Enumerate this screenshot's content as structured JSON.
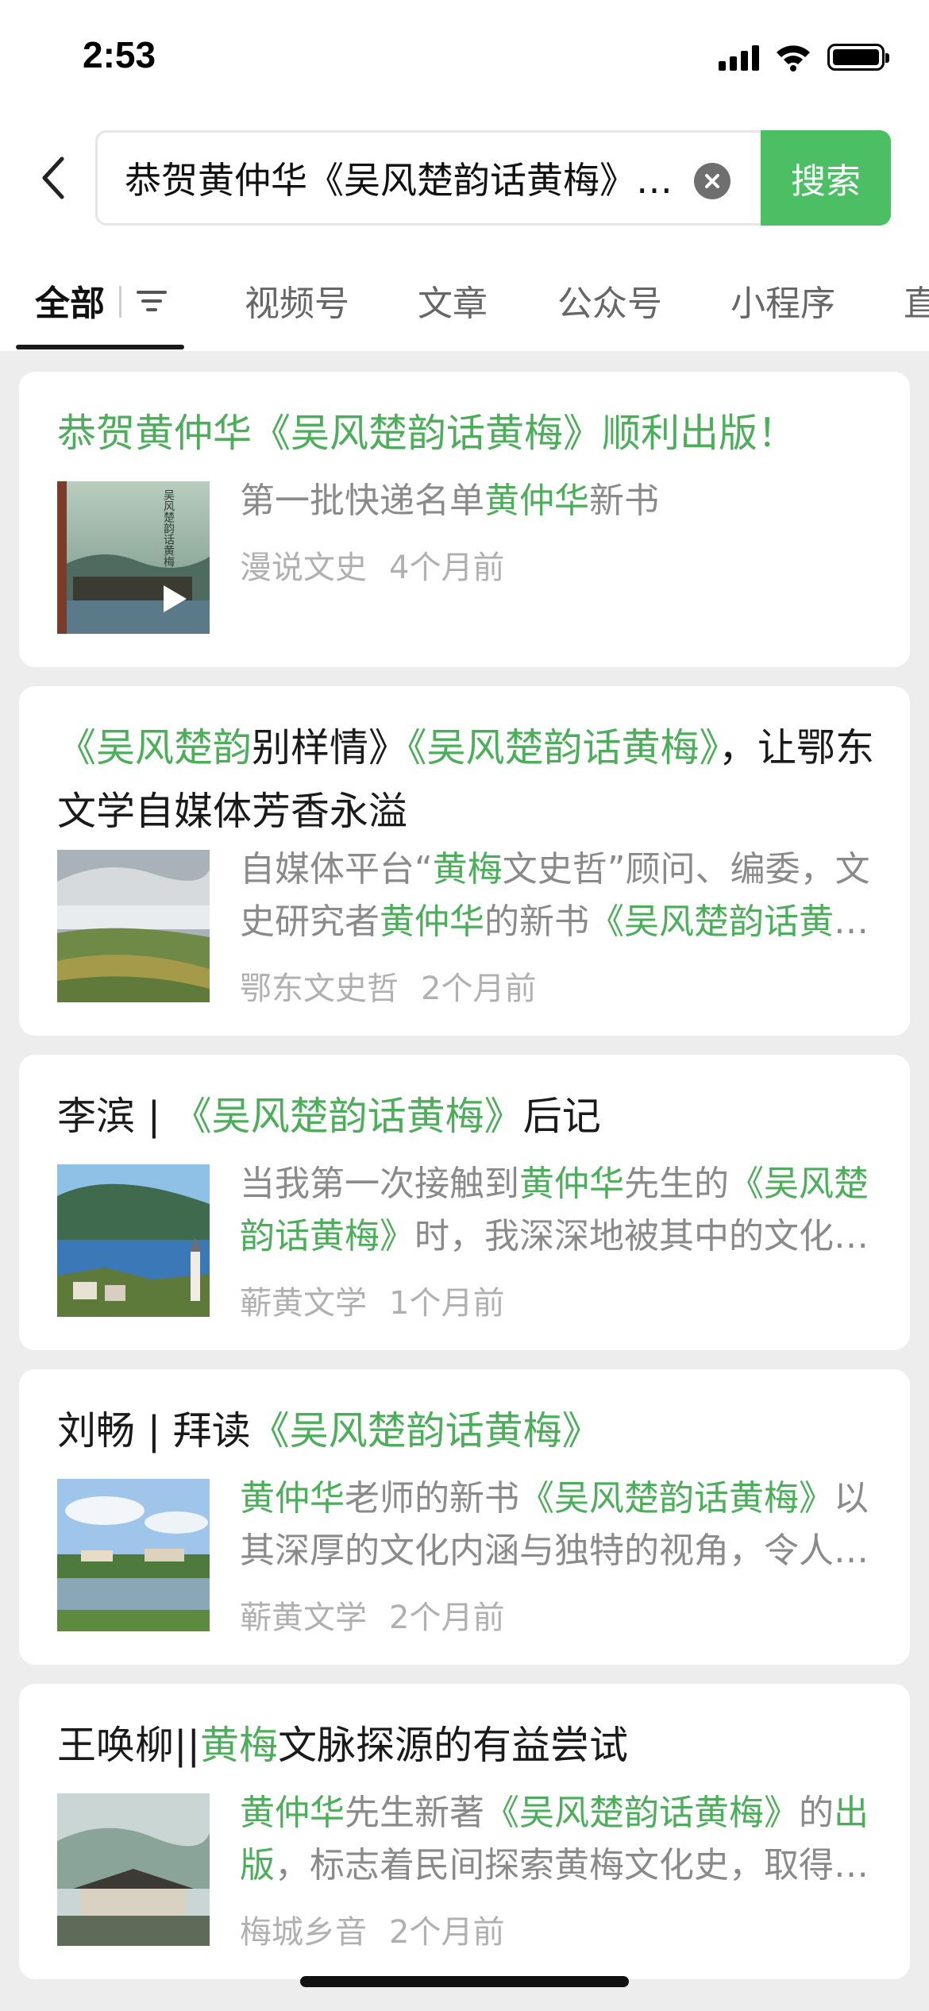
{
  "status_bar": {
    "time": "2:53",
    "icons": [
      "signal-icon",
      "wifi-icon",
      "battery-icon"
    ]
  },
  "search": {
    "query": "恭贺黄仲华《吴风楚韵话黄梅》顺利出版！",
    "button_label": "搜索",
    "back_icon": "chevron-left-icon",
    "clear_icon": "clear-icon"
  },
  "tabs": [
    {
      "label": "全部",
      "active": true
    },
    {
      "label": "视频号"
    },
    {
      "label": "文章"
    },
    {
      "label": "公众号"
    },
    {
      "label": "小程序"
    },
    {
      "label": "直"
    }
  ],
  "colors": {
    "accent": "#4cbe63",
    "highlight": "#4cad5a",
    "background": "#ededed"
  },
  "results": [
    {
      "title": [
        {
          "t": "恭贺黄仲华《吴风楚韵话黄梅》顺利出版！",
          "hl": true
        }
      ],
      "snippet": [
        {
          "t": "第一批快递名单"
        },
        {
          "t": "黄仲华",
          "hl": true
        },
        {
          "t": "新书"
        }
      ],
      "source": "漫说文史",
      "time": "4个月前",
      "has_video": true,
      "thumb_text": "吴风楚韵话黄梅"
    },
    {
      "title": [
        {
          "t": "《吴风楚韵",
          "hl": true
        },
        {
          "t": "别样情》"
        },
        {
          "t": "《吴风楚韵话黄梅》",
          "hl": true
        },
        {
          "t": "，让鄂东文学自媒体芳香永溢"
        }
      ],
      "snippet": [
        {
          "t": "自媒体平台“"
        },
        {
          "t": "黄梅",
          "hl": true
        },
        {
          "t": "文史哲”顾问、编委，文史研究者"
        },
        {
          "t": "黄仲华",
          "hl": true
        },
        {
          "t": "的新书"
        },
        {
          "t": "《吴风楚韵话黄梅》",
          "hl": true
        }
      ],
      "source": "鄂东文史哲",
      "time": "2个月前"
    },
    {
      "title": [
        {
          "t": "李滨 | "
        },
        {
          "t": "《吴风楚韵话黄梅》",
          "hl": true
        },
        {
          "t": "后记"
        }
      ],
      "snippet": [
        {
          "t": "当我第一次接触到"
        },
        {
          "t": "黄仲华",
          "hl": true
        },
        {
          "t": "先生的"
        },
        {
          "t": "《吴风楚韵话黄梅》",
          "hl": true
        },
        {
          "t": "时，我深深地被其中的文化底蕴所吸引"
        }
      ],
      "source": "蕲黄文学",
      "time": "1个月前"
    },
    {
      "title": [
        {
          "t": "刘畅 | 拜读"
        },
        {
          "t": "《吴风楚韵话黄梅》",
          "hl": true
        }
      ],
      "snippet": [
        {
          "t": "黄仲华",
          "hl": true
        },
        {
          "t": "老师的新书"
        },
        {
          "t": "《吴风楚韵话黄梅》",
          "hl": true
        },
        {
          "t": "以其深厚的文化内涵与独特的视角，令人耳目一新"
        }
      ],
      "source": "蕲黄文学",
      "time": "2个月前"
    },
    {
      "title": [
        {
          "t": "王唤柳||"
        },
        {
          "t": "黄梅",
          "hl": true
        },
        {
          "t": "文脉探源的有益尝试"
        }
      ],
      "snippet": [
        {
          "t": "黄仲华",
          "hl": true
        },
        {
          "t": "先生新著"
        },
        {
          "t": "《吴风楚韵话黄梅》",
          "hl": true
        },
        {
          "t": "的"
        },
        {
          "t": "出版",
          "hl": true
        },
        {
          "t": "，标志着民间探索黄梅文化史，取得了新的成果"
        }
      ],
      "source": "梅城乡音",
      "time": "2个月前"
    }
  ]
}
